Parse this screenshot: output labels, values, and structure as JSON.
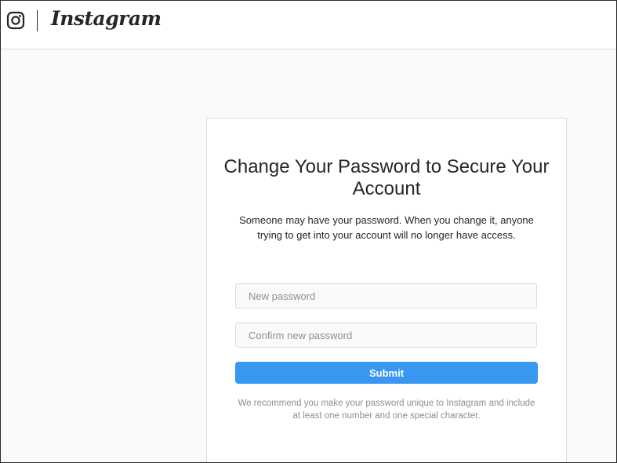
{
  "header": {
    "brand": "Instagram",
    "logo_icon": "instagram-camera-icon"
  },
  "card": {
    "title": "Change Your Password to Secure Your Account",
    "description": "Someone may have your password. When you change it, anyone trying to get into your account will no longer have access.",
    "new_password": {
      "placeholder": "New password",
      "value": ""
    },
    "confirm_password": {
      "placeholder": "Confirm new password",
      "value": ""
    },
    "submit_label": "Submit",
    "hint": "We recommend you make your password unique to Instagram and include at least one number and one special character."
  },
  "colors": {
    "accent": "#3897f0",
    "page_background": "#fafafa",
    "border": "#dbdbdb",
    "text": "#262626",
    "muted_text": "#8e8e8e"
  }
}
